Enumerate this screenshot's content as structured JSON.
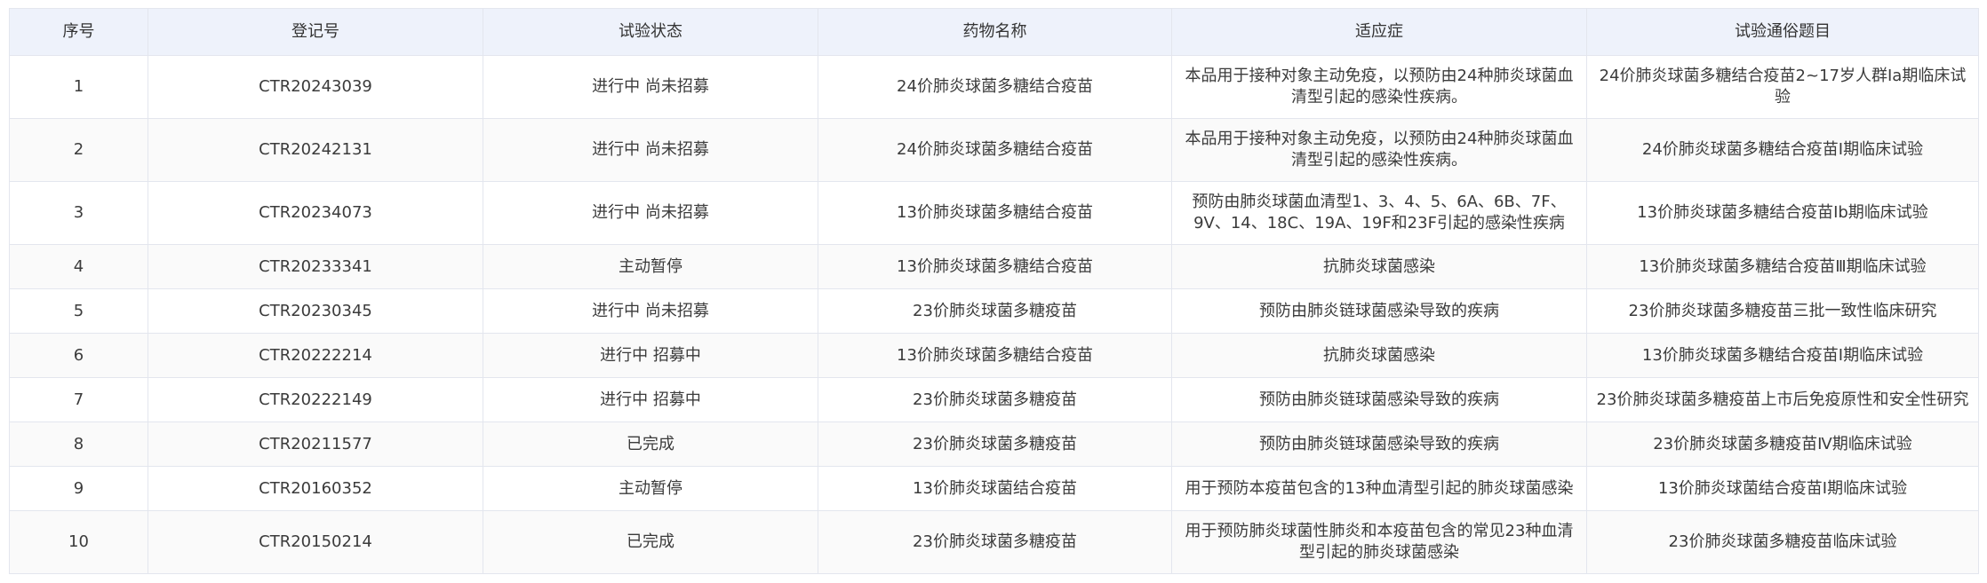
{
  "table": {
    "columns": [
      "序号",
      "登记号",
      "试验状态",
      "药物名称",
      "适应症",
      "试验通俗题目"
    ],
    "rows": [
      {
        "no": "1",
        "reg": "CTR20243039",
        "status": "进行中 尚未招募",
        "drug": "24价肺炎球菌多糖结合疫苗",
        "indication": "本品用于接种对象主动免疫，以预防由24种肺炎球菌血清型引起的感染性疾病。",
        "title": "24价肺炎球菌多糖结合疫苗2~17岁人群Ⅰa期临床试验"
      },
      {
        "no": "2",
        "reg": "CTR20242131",
        "status": "进行中 尚未招募",
        "drug": "24价肺炎球菌多糖结合疫苗",
        "indication": "本品用于接种对象主动免疫，以预防由24种肺炎球菌血清型引起的感染性疾病。",
        "title": "24价肺炎球菌多糖结合疫苗Ⅰ期临床试验"
      },
      {
        "no": "3",
        "reg": "CTR20234073",
        "status": "进行中 尚未招募",
        "drug": "13价肺炎球菌多糖结合疫苗",
        "indication": "预防由肺炎球菌血清型1、3、4、5、6A、6B、7F、9V、14、18C、19A、19F和23F引起的感染性疾病",
        "title": "13价肺炎球菌多糖结合疫苗Ⅰb期临床试验"
      },
      {
        "no": "4",
        "reg": "CTR20233341",
        "status": "主动暂停",
        "drug": "13价肺炎球菌多糖结合疫苗",
        "indication": "抗肺炎球菌感染",
        "title": "13价肺炎球菌多糖结合疫苗Ⅲ期临床试验"
      },
      {
        "no": "5",
        "reg": "CTR20230345",
        "status": "进行中 尚未招募",
        "drug": "23价肺炎球菌多糖疫苗",
        "indication": "预防由肺炎链球菌感染导致的疾病",
        "title": "23价肺炎球菌多糖疫苗三批一致性临床研究"
      },
      {
        "no": "6",
        "reg": "CTR20222214",
        "status": "进行中 招募中",
        "drug": "13价肺炎球菌多糖结合疫苗",
        "indication": "抗肺炎球菌感染",
        "title": "13价肺炎球菌多糖结合疫苗Ⅰ期临床试验"
      },
      {
        "no": "7",
        "reg": "CTR20222149",
        "status": "进行中 招募中",
        "drug": "23价肺炎球菌多糖疫苗",
        "indication": "预防由肺炎链球菌感染导致的疾病",
        "title": "23价肺炎球菌多糖疫苗上市后免疫原性和安全性研究"
      },
      {
        "no": "8",
        "reg": "CTR20211577",
        "status": "已完成",
        "drug": "23价肺炎球菌多糖疫苗",
        "indication": "预防由肺炎链球菌感染导致的疾病",
        "title": "23价肺炎球菌多糖疫苗Ⅳ期临床试验"
      },
      {
        "no": "9",
        "reg": "CTR20160352",
        "status": "主动暂停",
        "drug": "13价肺炎球菌结合疫苗",
        "indication": "用于预防本疫苗包含的13种血清型引起的肺炎球菌感染",
        "title": "13价肺炎球菌结合疫苗Ⅰ期临床试验"
      },
      {
        "no": "10",
        "reg": "CTR20150214",
        "status": "已完成",
        "drug": "23价肺炎球菌多糖疫苗",
        "indication": "用于预防肺炎球菌性肺炎和本疫苗包含的常见23种血清型引起的肺炎球菌感染",
        "title": "23价肺炎球菌多糖疫苗临床试验"
      }
    ]
  }
}
